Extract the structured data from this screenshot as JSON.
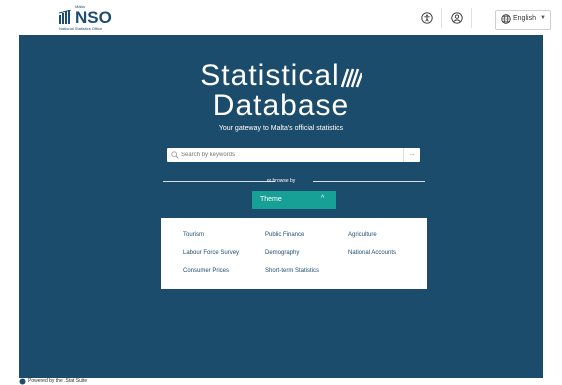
{
  "header": {
    "logo_text": "NSO",
    "logo_malta": "Malta",
    "logo_subtitle": "National Statistics Office",
    "accessibility_icon": "accessibility-icon",
    "account_icon": "user-account-icon",
    "language": {
      "label": "English",
      "icon": "globe-icon"
    }
  },
  "hero": {
    "title_line1": "Statistical",
    "title_line2": "Database",
    "tagline": "Your gateway to Malta's official statistics",
    "search": {
      "placeholder": "Search by keywords"
    },
    "browse_by": "or browse by",
    "theme_button": "Theme"
  },
  "themes": {
    "col1": [
      "Tourism",
      "Labour Force Survey",
      "Consumer Prices"
    ],
    "col2": [
      "Public Finance",
      "Demography",
      "Short-term Statistics"
    ],
    "col3": [
      "Agriculture",
      "National Accounts"
    ]
  },
  "footer": {
    "text": "Powered by the .Stat Suite"
  },
  "colors": {
    "hero": "#1c4c6b",
    "accent": "#17a096",
    "brand": "#1e4d72"
  }
}
